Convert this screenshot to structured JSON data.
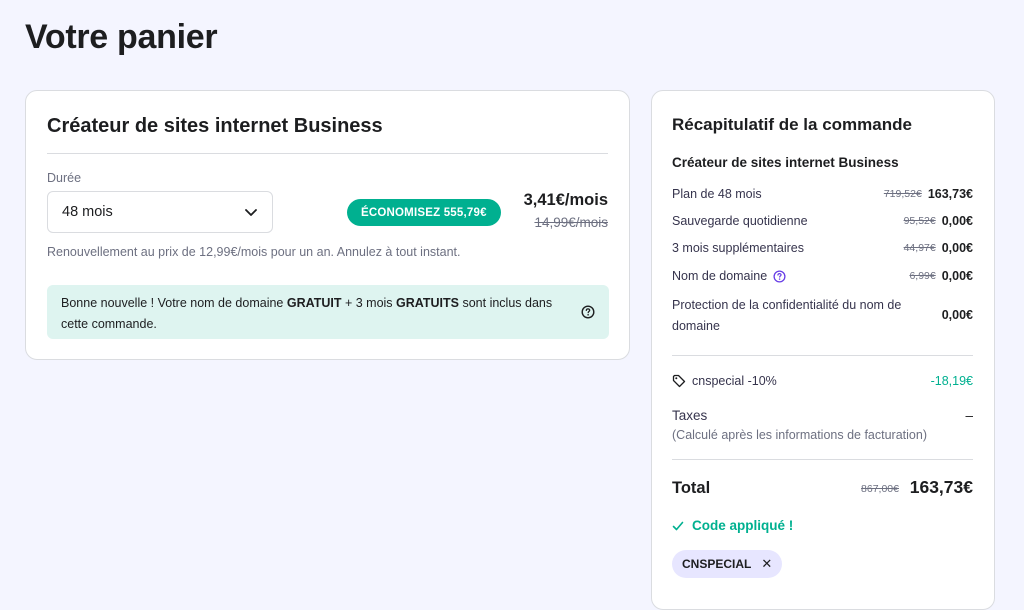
{
  "page": {
    "title": "Votre panier"
  },
  "plan": {
    "title": "Créateur de sites internet Business",
    "duration_label": "Durée",
    "duration_value": "48 mois",
    "save_badge": "ÉCONOMISEZ 555,79€",
    "price_now": "3,41€/mois",
    "price_old": "14,99€/mois",
    "renewal": "Renouvellement au prix de 12,99€/mois pour un an. Annulez à tout instant.",
    "notice": {
      "part1": "Bonne nouvelle ! Votre nom de domaine ",
      "bold1": "GRATUIT",
      "part2": " + 3 mois ",
      "bold2": "GRATUITS",
      "part3": " sont inclus dans cette commande."
    }
  },
  "summary": {
    "title": "Récapitulatif de la commande",
    "subtitle": "Créateur de sites internet Business",
    "lines": [
      {
        "label": "Plan de 48 mois",
        "old": "719,52€",
        "value": "163,73€"
      },
      {
        "label": "Sauvegarde quotidienne",
        "old": "95,52€",
        "value": "0,00€"
      },
      {
        "label": "3 mois supplémentaires",
        "old": "44,97€",
        "value": "0,00€"
      },
      {
        "label": "Nom de domaine",
        "old": "6,99€",
        "value": "0,00€"
      },
      {
        "label": "Protection de la confidentialité du nom de domaine",
        "value": "0,00€"
      }
    ],
    "discount": {
      "label": "cnspecial -10%",
      "value": "-18,19€"
    },
    "taxes": {
      "label": "Taxes",
      "value": "–",
      "note": "(Calculé après les informations de facturation)"
    },
    "total": {
      "label": "Total",
      "old": "867,00€",
      "value": "163,73€"
    },
    "applied": "Code appliqué !",
    "coupon": "CNSPECIAL"
  },
  "colors": {
    "accent": "#00b090",
    "background": "#f4f5ff",
    "notice_bg": "#def4f0",
    "chip_bg": "#e7e6ff"
  }
}
